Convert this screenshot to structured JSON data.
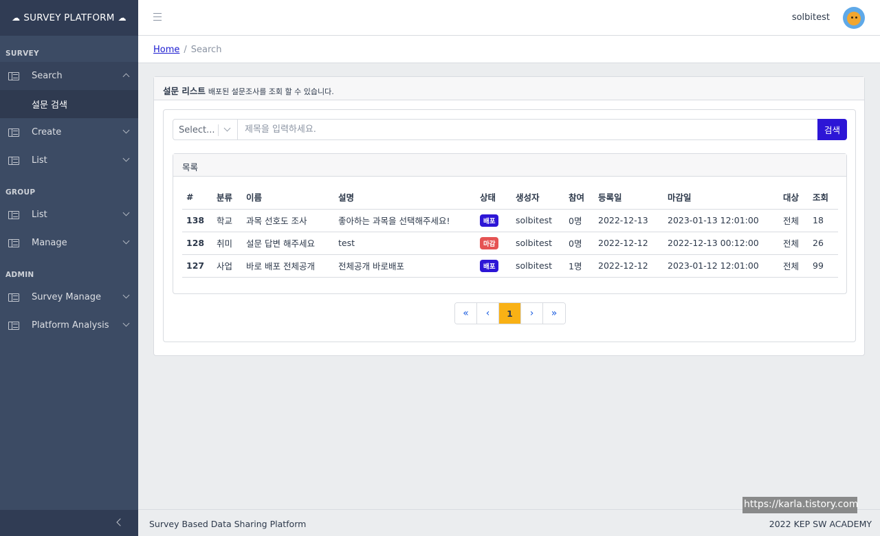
{
  "brand": {
    "title": "SURVEY PLATFORM"
  },
  "sidebar": {
    "sections": [
      {
        "title": "SURVEY",
        "items": [
          {
            "label": "Search",
            "open": true,
            "sub": [
              "설문 검색"
            ]
          },
          {
            "label": "Create"
          },
          {
            "label": "List"
          }
        ]
      },
      {
        "title": "GROUP",
        "items": [
          {
            "label": "List"
          },
          {
            "label": "Manage"
          }
        ]
      },
      {
        "title": "ADMIN",
        "items": [
          {
            "label": "Survey Manage"
          },
          {
            "label": "Platform Analysis"
          }
        ]
      }
    ]
  },
  "header": {
    "username": "solbitest"
  },
  "breadcrumb": {
    "home": "Home",
    "separator": "/",
    "current": "Search"
  },
  "card": {
    "title": "설문 리스트",
    "subtitle": "배포된 설문조사를 조회 할 수 있습니다."
  },
  "search": {
    "select_placeholder": "Select...",
    "input_placeholder": "제목을 입력하세요.",
    "button": "검색"
  },
  "list": {
    "title": "목록",
    "columns": [
      "#",
      "분류",
      "이름",
      "설명",
      "상태",
      "생성자",
      "참여",
      "등록일",
      "마감일",
      "대상",
      "조회"
    ],
    "rows": [
      {
        "id": "138",
        "category": "학교",
        "name": "과목 선호도 조사",
        "desc": "좋아하는 과목을 선택해주세요!",
        "status": "배포",
        "status_color": "#2d16d6",
        "creator": "solbitest",
        "join": "0명",
        "reg": "2022-12-13",
        "due": "2023-01-13 12:01:00",
        "target": "전체",
        "views": "18"
      },
      {
        "id": "128",
        "category": "취미",
        "name": "설문 답변 해주세요",
        "desc": "test",
        "status": "마감",
        "status_color": "#e55353",
        "creator": "solbitest",
        "join": "0명",
        "reg": "2022-12-12",
        "due": "2022-12-13 00:12:00",
        "target": "전체",
        "views": "26"
      },
      {
        "id": "127",
        "category": "사업",
        "name": "바로 배포 전체공개",
        "desc": "전체공개 바로배포",
        "status": "배포",
        "status_color": "#2d16d6",
        "creator": "solbitest",
        "join": "1명",
        "reg": "2022-12-12",
        "due": "2023-01-12 12:01:00",
        "target": "전체",
        "views": "99"
      }
    ]
  },
  "pagination": {
    "first": "«",
    "prev": "‹",
    "current": "1",
    "next": "›",
    "last": "»"
  },
  "footer": {
    "left": "Survey Based Data Sharing Platform",
    "right": "2022 KEP SW ACADEMY"
  },
  "watermark": "https://karla.tistory.com",
  "colors": {
    "sidebar": "#3c4b64",
    "primary": "#2d16d6",
    "danger": "#e55353",
    "warning": "#f9b115"
  }
}
